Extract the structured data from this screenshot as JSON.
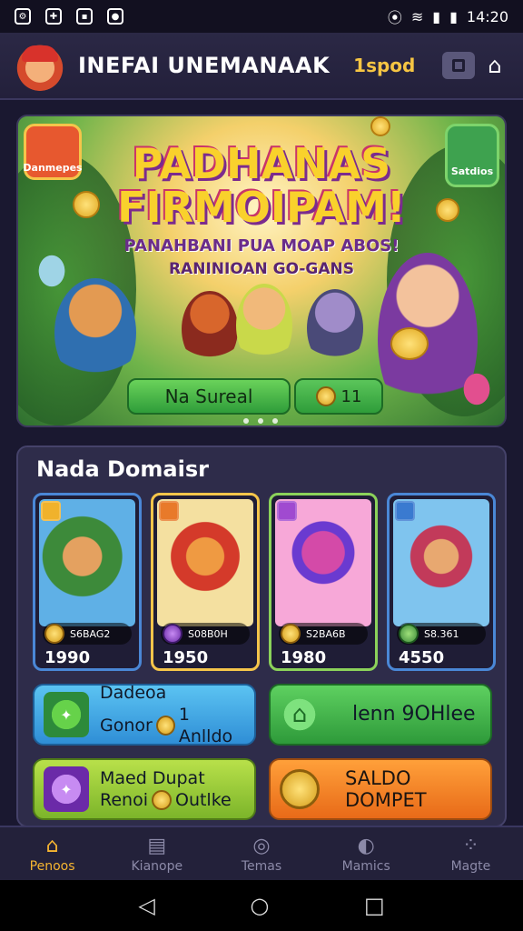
{
  "status_bar": {
    "time": "14:20"
  },
  "header": {
    "app_title": "INEFAI UNEMANAAK",
    "coin_balance": "1spod"
  },
  "hero": {
    "badge_left": "Danmepes",
    "badge_right": "Satdios",
    "title_line1": "PADHANAS",
    "title_line2": "FIRMOIPAM!",
    "subtitle": "PANAHBANI PUA MOAP ABOS!",
    "tagline": "RANINIOAN GO-GANS",
    "primary_button": "Na Sureal",
    "coin_button": "11"
  },
  "panel": {
    "title": "Nada Domaisr",
    "games": [
      {
        "chip": "S6BAG2",
        "price": "1990"
      },
      {
        "chip": "S08B0H",
        "price": "1950"
      },
      {
        "chip": "S2BA6B",
        "price": "1980"
      },
      {
        "chip": "S8.361",
        "price": "4550"
      }
    ],
    "actions": [
      {
        "line1": "Dadeoa",
        "line2a": "Gonor",
        "line2b": "1 Anlldo"
      },
      {
        "label": "lenn 9OHlee"
      },
      {
        "line1": "Maed Dupat",
        "line2a": "Renoi",
        "line2b": "Outlke"
      },
      {
        "label": "SALDO DOMPET"
      }
    ]
  },
  "bottom_nav": [
    {
      "label": "Penoos",
      "icon": "home-icon"
    },
    {
      "label": "Kianope",
      "icon": "book-icon"
    },
    {
      "label": "Temas",
      "icon": "target-icon"
    },
    {
      "label": "Mamics",
      "icon": "globe-icon"
    },
    {
      "label": "Magte",
      "icon": "grid-icon"
    }
  ],
  "colors": {
    "accent": "#f6b531",
    "background": "#1a1830",
    "panel": "#2e2c4a"
  }
}
